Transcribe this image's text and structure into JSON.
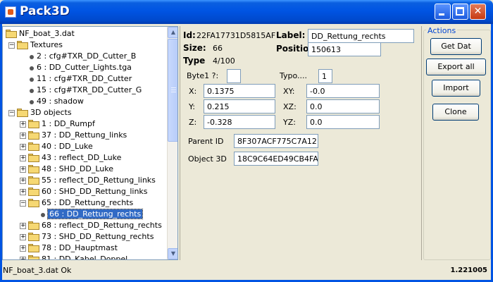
{
  "window": {
    "title": "Pack3D"
  },
  "tree": {
    "rows": [
      {
        "label": "NF_boat_3.dat",
        "kind": "folder",
        "level": 0,
        "expander": "",
        "selected": false
      },
      {
        "label": "Textures",
        "kind": "folder",
        "level": 1,
        "expander": "−",
        "selected": false
      },
      {
        "label": "2 : cfg#TXR_DD_Cutter_B",
        "kind": "leaf",
        "level": 2,
        "expander": "",
        "selected": false
      },
      {
        "label": "6 : DD_Cutter_Lights.tga",
        "kind": "leaf",
        "level": 2,
        "expander": "",
        "selected": false
      },
      {
        "label": "11 : cfg#TXR_DD_Cutter",
        "kind": "leaf",
        "level": 2,
        "expander": "",
        "selected": false
      },
      {
        "label": "15 : cfg#TXR_DD_Cutter_G",
        "kind": "leaf",
        "level": 2,
        "expander": "",
        "selected": false
      },
      {
        "label": "49 : shadow",
        "kind": "leaf",
        "level": 2,
        "expander": "",
        "selected": false
      },
      {
        "label": "3D objects",
        "kind": "folder",
        "level": 1,
        "expander": "−",
        "selected": false
      },
      {
        "label": "1 : DD_Rumpf",
        "kind": "folder",
        "level": 2,
        "expander": "+",
        "selected": false
      },
      {
        "label": "37 : DD_Rettung_links",
        "kind": "folder",
        "level": 2,
        "expander": "+",
        "selected": false
      },
      {
        "label": "40 : DD_Luke",
        "kind": "folder",
        "level": 2,
        "expander": "+",
        "selected": false
      },
      {
        "label": "43 : reflect_DD_Luke",
        "kind": "folder",
        "level": 2,
        "expander": "+",
        "selected": false
      },
      {
        "label": "48 : SHD_DD_Luke",
        "kind": "folder",
        "level": 2,
        "expander": "+",
        "selected": false
      },
      {
        "label": "55 : reflect_DD_Rettung_links",
        "kind": "folder",
        "level": 2,
        "expander": "+",
        "selected": false
      },
      {
        "label": "60 : SHD_DD_Rettung_links",
        "kind": "folder",
        "level": 2,
        "expander": "+",
        "selected": false
      },
      {
        "label": "65 : DD_Rettung_rechts",
        "kind": "folder",
        "level": 2,
        "expander": "−",
        "selected": false
      },
      {
        "label": "66 : DD_Rettung_rechts",
        "kind": "leaf",
        "level": 3,
        "expander": "",
        "selected": true
      },
      {
        "label": "68 : reflect_DD_Rettung_rechts",
        "kind": "folder",
        "level": 2,
        "expander": "+",
        "selected": false
      },
      {
        "label": "73 : SHD_DD_Rettung_rechts",
        "kind": "folder",
        "level": 2,
        "expander": "+",
        "selected": false
      },
      {
        "label": "78 : DD_Hauptmast",
        "kind": "folder",
        "level": 2,
        "expander": "+",
        "selected": false
      },
      {
        "label": "81 : DD_Kabel_Doppel",
        "kind": "folder",
        "level": 2,
        "expander": "+",
        "selected": false
      }
    ]
  },
  "details": {
    "id_label": "Id:",
    "id_value": "22FA17731D5815AF",
    "size_label": "Size:",
    "size_value": "66",
    "type_label": "Type",
    "type_value": "4/100",
    "label_label": "Label:",
    "label_value": "DD_Rettung_rechts",
    "position_label": "Position:",
    "position_value": "150613",
    "byte1_label": "Byte1 ?:",
    "byte1_value": "",
    "typo_label": "Typo....",
    "typo_value": "1",
    "x_label": "X:",
    "x_value": "0.1375",
    "y_label": "Y:",
    "y_value": "0.215",
    "z_label": "Z:",
    "z_value": "-0.328",
    "xy_label": "XY:",
    "xy_value": "-0.0",
    "xz_label": "XZ:",
    "xz_value": "0.0",
    "yz_label": "YZ:",
    "yz_value": "0.0",
    "parent_label": "Parent ID",
    "parent_value": "8F307ACF775C7A12",
    "object3d_label": "Object 3D",
    "object3d_value": "18C9C64ED49CB4FA"
  },
  "actions": {
    "title": "Actions",
    "get_dat": "Get Dat",
    "export_all": "Export all",
    "import": "Import",
    "clone": "Clone"
  },
  "status": {
    "message": "NF_boat_3.dat Ok",
    "version": "1.221005"
  },
  "colors": {
    "titlebar": "#0054e3",
    "selection": "#316ac5",
    "window_bg": "#ece9d8"
  }
}
